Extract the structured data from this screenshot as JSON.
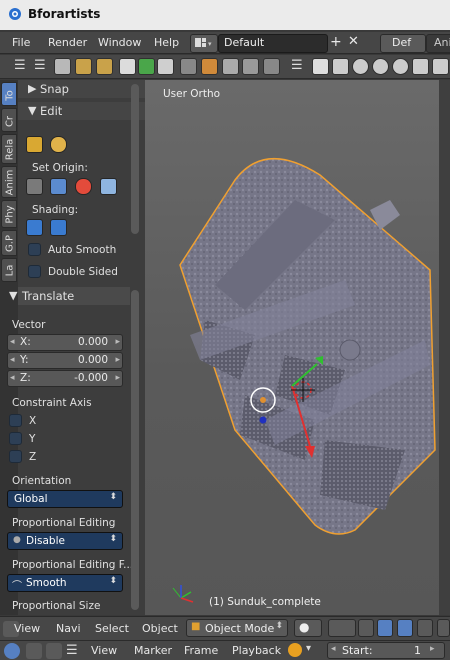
{
  "app": {
    "title": "Bforartists"
  },
  "menubar": {
    "items": [
      "File",
      "Render",
      "Window",
      "Help"
    ],
    "layout_name": "Default",
    "tab_def": "Def",
    "tab_ani": "Ani"
  },
  "sidetabs": [
    "To",
    "Cr",
    "Rela",
    "Anim",
    "Phy",
    "G.P",
    "La"
  ],
  "panel": {
    "snap": "Snap",
    "edit": "Edit",
    "set_origin": "Set Origin:",
    "shading": "Shading:",
    "auto_smooth": "Auto Smooth",
    "double_sided": "Double Sided",
    "translate": "Translate",
    "vector": "Vector",
    "vx_label": "X:",
    "vx_value": "0.000",
    "vy_label": "Y:",
    "vy_value": "0.000",
    "vz_label": "Z:",
    "vz_value": "-0.000",
    "constraint_axis": "Constraint Axis",
    "axis_x": "X",
    "axis_y": "Y",
    "axis_z": "Z",
    "orientation": "Orientation",
    "orientation_value": "Global",
    "prop_editing": "Proportional Editing",
    "prop_editing_value": "Disable",
    "prop_falloff": "Proportional Editing F...",
    "prop_falloff_value": "Smooth",
    "prop_size": "Proportional Size"
  },
  "viewport": {
    "title": "User Ortho",
    "object_label": "(1) Sunduk_complete"
  },
  "header3d": {
    "items": [
      "View",
      "Navi",
      "Select",
      "Object"
    ],
    "mode": "Object Mode"
  },
  "timeline": {
    "items": [
      "View",
      "Marker",
      "Frame",
      "Playback"
    ],
    "start_label": "Start:",
    "start_value": "1"
  },
  "colors": {
    "accent": "#5680c2",
    "selection_outline": "#f0a030",
    "axis_x": "#e03030",
    "axis_y": "#30c030",
    "axis_z": "#3050e0"
  }
}
